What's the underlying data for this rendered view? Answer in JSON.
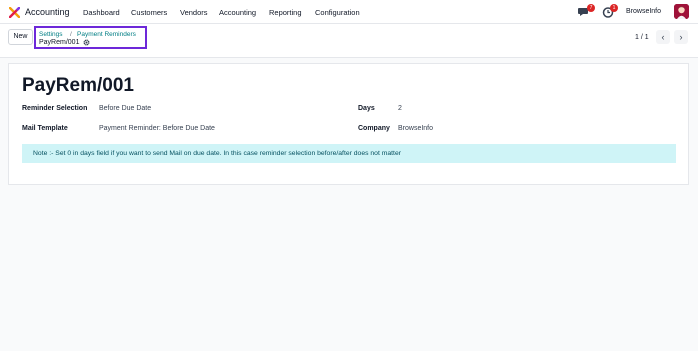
{
  "navbar": {
    "app_name": "Accounting",
    "menu": [
      "Dashboard",
      "Customers",
      "Vendors",
      "Accounting",
      "Reporting",
      "Configuration"
    ],
    "messages_count": "7",
    "activities_count": "1",
    "company": "BrowseInfo"
  },
  "control_panel": {
    "new_label": "New",
    "breadcrumb": [
      "Settings",
      "Payment Reminders"
    ],
    "breadcrumb_sep": "/",
    "record_name": "PayRem/001",
    "pager": "1 / 1",
    "prev": "‹",
    "next": "›"
  },
  "form": {
    "title": "PayRem/001",
    "reminder_selection_label": "Reminder Selection",
    "reminder_selection_value": "Before Due Date",
    "days_label": "Days",
    "days_value": "2",
    "mail_template_label": "Mail Template",
    "mail_template_value": "Payment Reminder: Before Due Date",
    "company_label": "Company",
    "company_value": "BrowseInfo",
    "note": "Note :- Set 0 in days field if you want to send Mail on due date. In this case reminder selection before/after does not matter"
  },
  "colors": {
    "accent": "#017e84",
    "highlight_border": "#6d28d9",
    "note_bg": "#cff4f7",
    "badge": "#dc2626"
  }
}
